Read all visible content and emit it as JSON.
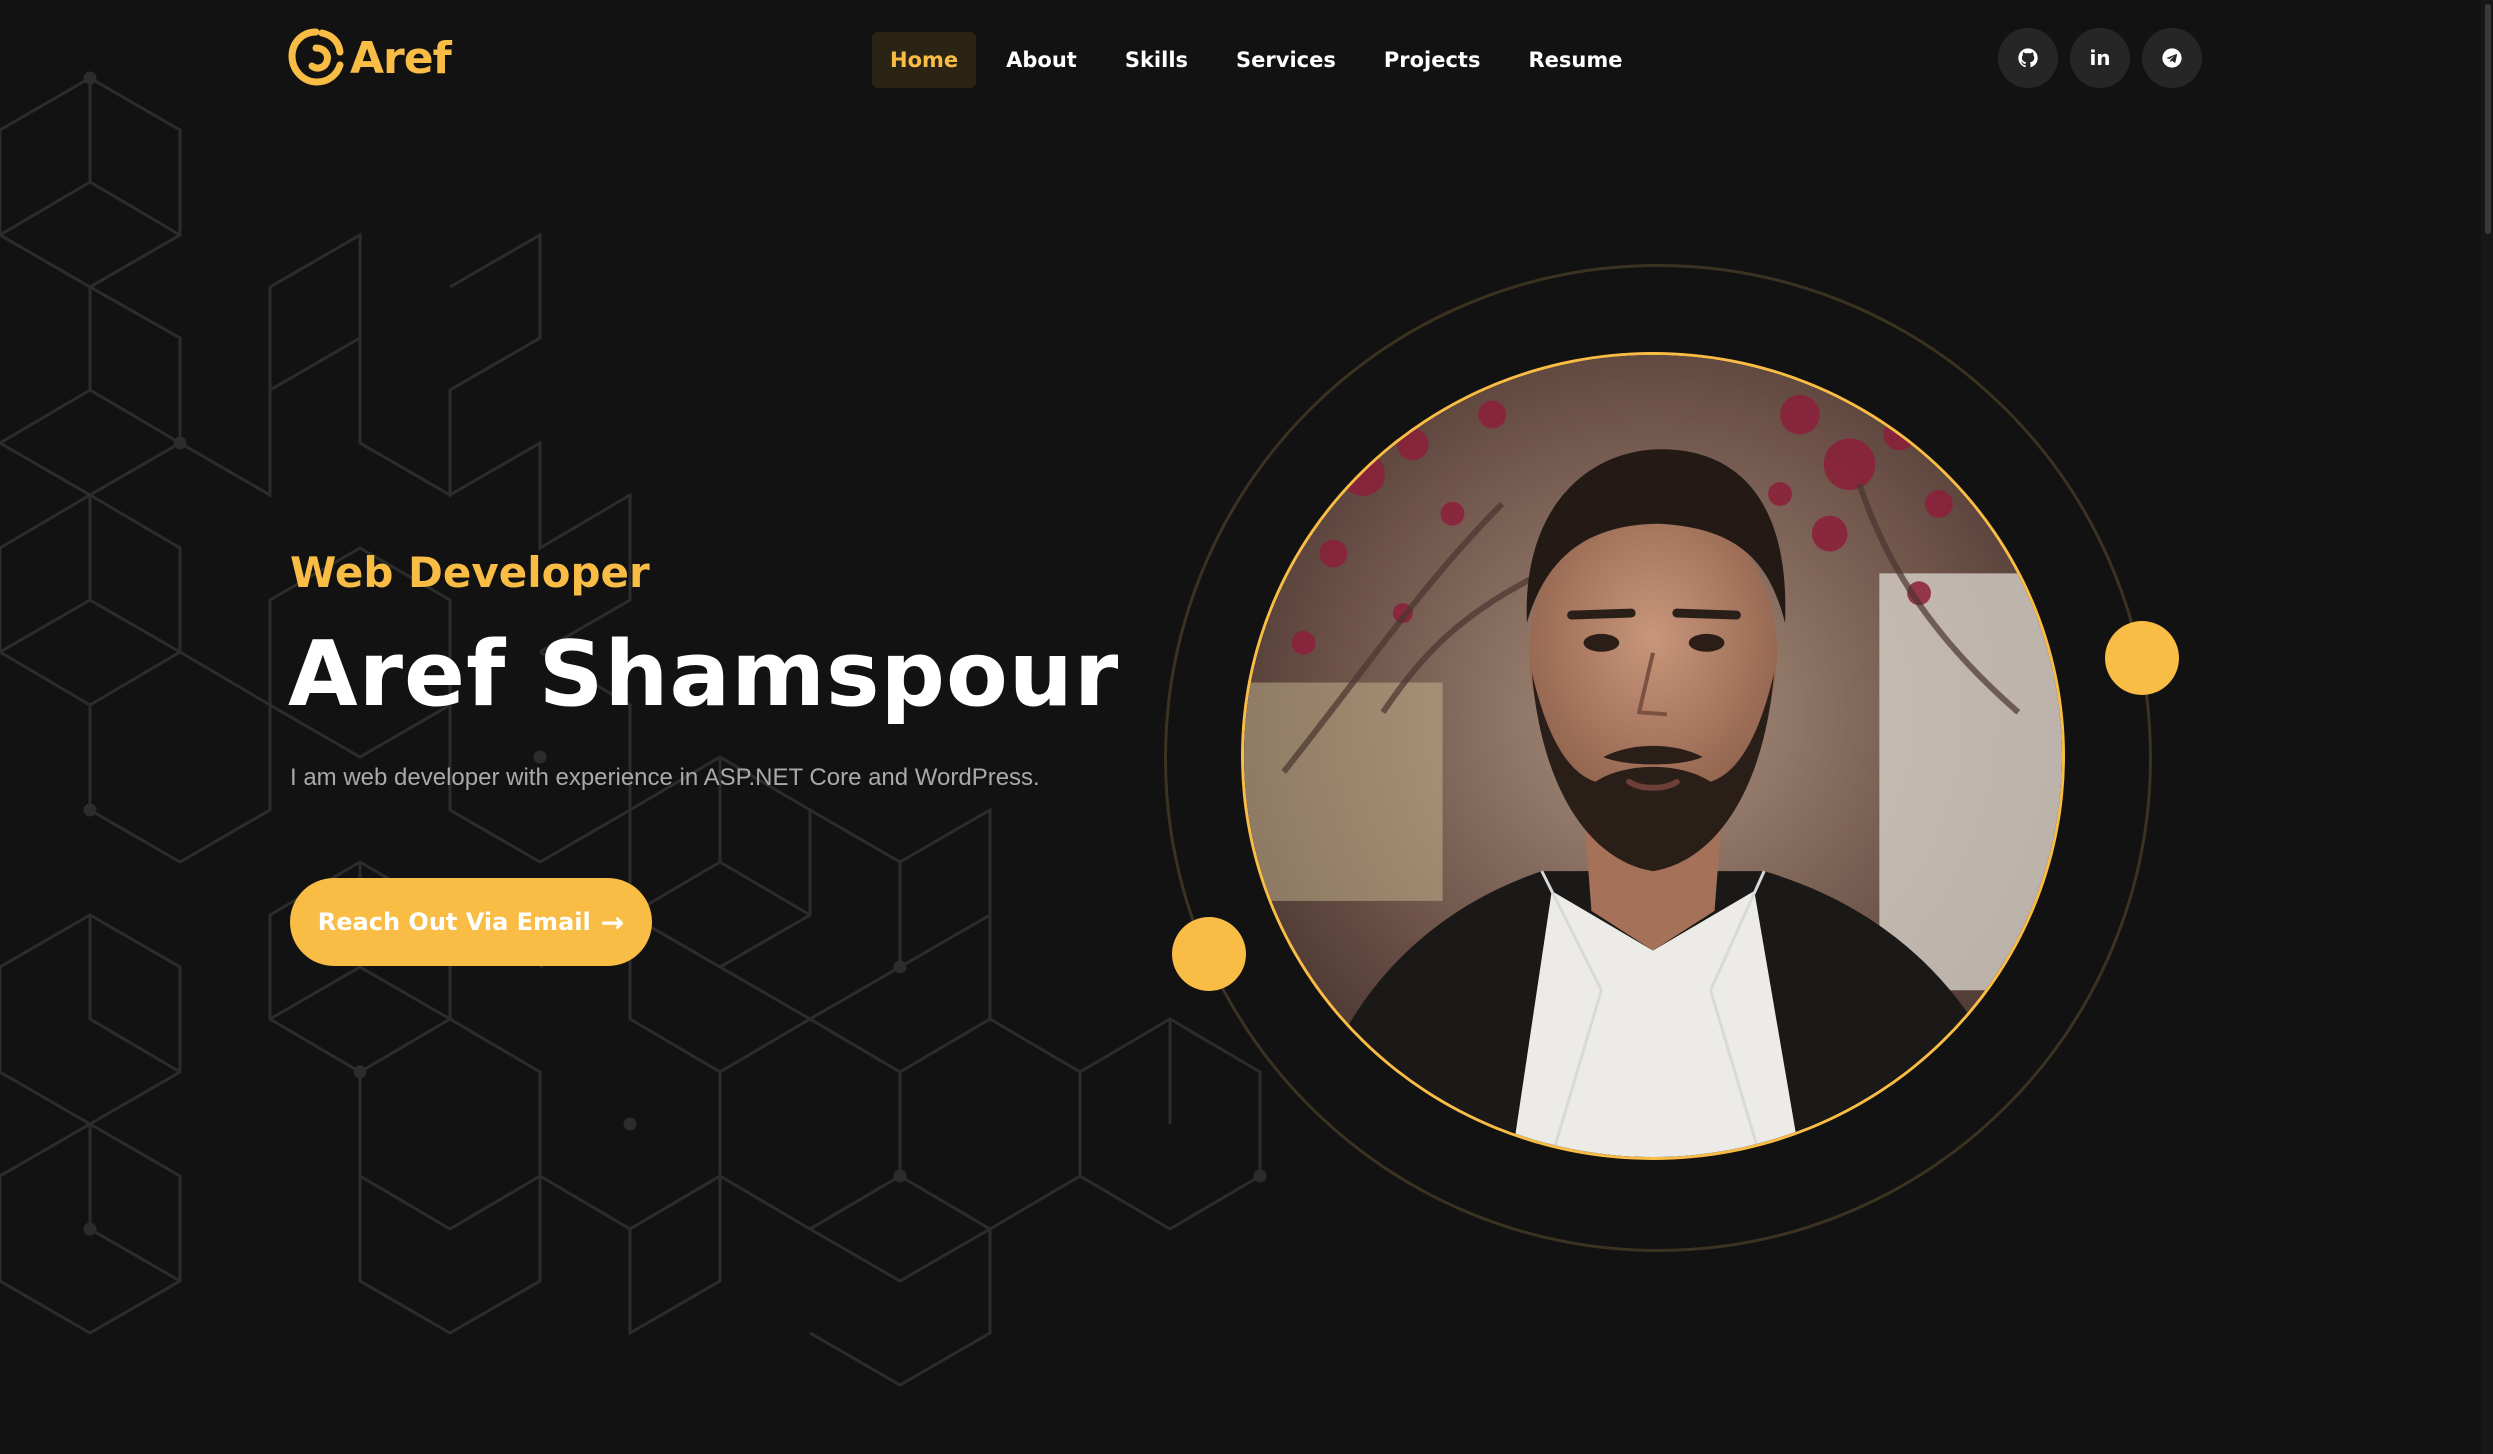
{
  "brand": {
    "name": "Aref",
    "icon": "swirl-logo-icon",
    "accent_color": "#f9bd45",
    "background_color": "#121212"
  },
  "nav": {
    "items": [
      {
        "label": "Home",
        "active": true
      },
      {
        "label": "About",
        "active": false
      },
      {
        "label": "Skills",
        "active": false
      },
      {
        "label": "Services",
        "active": false
      },
      {
        "label": "Projects",
        "active": false
      },
      {
        "label": "Resume",
        "active": false
      }
    ]
  },
  "socials": [
    {
      "icon": "github-icon"
    },
    {
      "icon": "linkedin-icon",
      "glyph": "in"
    },
    {
      "icon": "telegram-icon"
    }
  ],
  "hero": {
    "subtitle": "Web Developer",
    "title": "Aref Shamspour",
    "description": "I am web developer with experience in ASP.NET Core and WordPress.",
    "cta_label": "Reach Out Via Email",
    "cta_icon": "arrow-right-icon",
    "photo_icon": "profile-photo"
  }
}
